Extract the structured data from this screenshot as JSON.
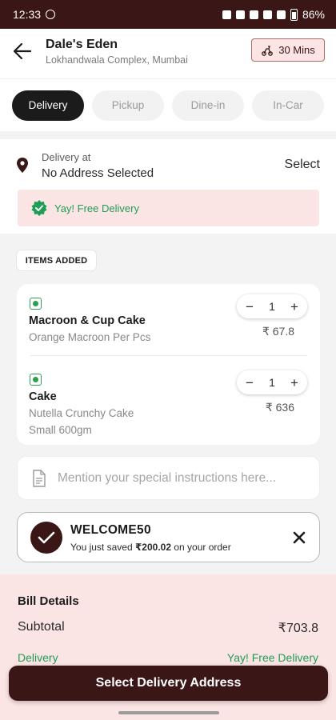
{
  "status_bar": {
    "time": "12:33",
    "battery": "86%"
  },
  "header": {
    "store_name": "Dale's Eden",
    "store_address": "Lokhandwala Complex, Mumbai",
    "eta": "30 Mins"
  },
  "tabs": [
    {
      "label": "Delivery",
      "active": true
    },
    {
      "label": "Pickup",
      "active": false
    },
    {
      "label": "Dine-in",
      "active": false
    },
    {
      "label": "In-Car",
      "active": false
    }
  ],
  "address": {
    "label": "Delivery at",
    "value": "No Address Selected",
    "action": "Select",
    "free_delivery_text": "Yay! Free Delivery"
  },
  "items_section": {
    "chip": "ITEMS ADDED",
    "items": [
      {
        "name": "Macroon & Cup Cake",
        "description": "Orange Macroon Per Pcs",
        "variant": "",
        "quantity": "1",
        "price": "₹ 67.8"
      },
      {
        "name": "Cake",
        "description": "Nutella Crunchy Cake",
        "variant": "Small 600gm",
        "quantity": "1",
        "price": "₹ 636"
      }
    ],
    "minus": "−",
    "plus": "+"
  },
  "instructions": {
    "placeholder": "Mention your special instructions here..."
  },
  "coupon": {
    "code": "WELCOME50",
    "msg_prefix": "You just saved ",
    "msg_amount": "₹200.02",
    "msg_suffix": " on your order"
  },
  "bill": {
    "title": "Bill Details",
    "subtotal_label": "Subtotal",
    "subtotal_value": "₹703.8",
    "delivery_label": "Delivery",
    "delivery_value": "Yay! Free Delivery"
  },
  "cta": {
    "label": "Select Delivery Address"
  },
  "colors": {
    "brand": "#3b1616",
    "accent_bg": "#fbe4e4",
    "success": "#1f9d55",
    "veg": "#2e9e4f"
  }
}
